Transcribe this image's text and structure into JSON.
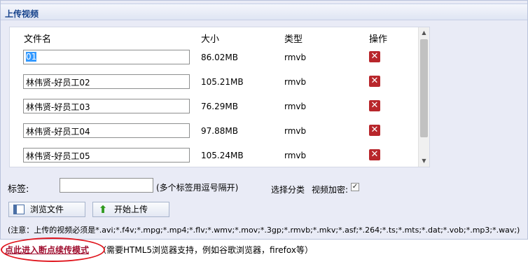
{
  "panel": {
    "title": "上传视频"
  },
  "table": {
    "headers": {
      "name": "文件名",
      "size": "大小",
      "type": "类型",
      "action": "操作"
    },
    "rows": [
      {
        "name": "01",
        "size": "86.02MB",
        "type": "rmvb",
        "selected": true
      },
      {
        "name": "林伟贤-好员工02",
        "size": "105.21MB",
        "type": "rmvb"
      },
      {
        "name": "林伟贤-好员工03",
        "size": "76.29MB",
        "type": "rmvb"
      },
      {
        "name": "林伟贤-好员工04",
        "size": "97.88MB",
        "type": "rmvb"
      },
      {
        "name": "林伟贤-好员工05",
        "size": "105.24MB",
        "type": "rmvb"
      }
    ],
    "delete_icon": "delete-x-icon"
  },
  "form": {
    "tags_label": "标签:",
    "tags_value": "",
    "tags_hint": "(多个标签用逗号隔开)",
    "category_label": "选择分类",
    "encrypt_label": "视频加密:",
    "encrypt_checked": true
  },
  "buttons": {
    "browse": "浏览文件",
    "upload": "开始上传"
  },
  "note": "(注意：上传的视频必须是*.avi;*.f4v;*.mpg;*.mp4;*.flv;*.wmv;*.mov;*.3gp;*.rmvb;*.mkv;*.asf;*.264;*.ts;*.mts;*.dat;*.vob;*.mp3;*.wav;)",
  "resume": {
    "link": "点此进入断点续传模式",
    "hint": "（需要HTML5浏览器支持，例如谷歌浏览器，firefox等）"
  },
  "colors": {
    "accent": "#15428b",
    "delete": "#b8262b",
    "highlight": "#e0161e"
  }
}
